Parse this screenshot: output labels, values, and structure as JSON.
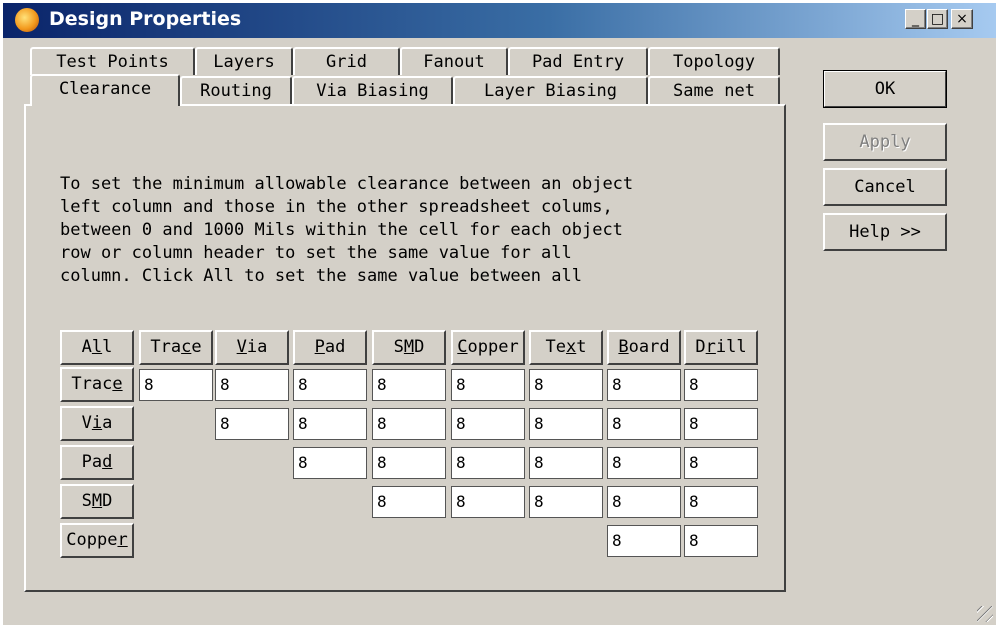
{
  "window": {
    "title": "Design Properties",
    "minimize_glyph": "_",
    "maximize_glyph": "□",
    "close_glyph": "×"
  },
  "tabs_row_back": [
    "Test Points",
    "Layers",
    "Grid",
    "Fanout",
    "Pad Entry",
    "Topology"
  ],
  "tabs_row_front": [
    "Clearance",
    "Routing",
    "Via Biasing",
    "Layer Biasing",
    "Same net"
  ],
  "active_tab": "Clearance",
  "description": [
    "To set the minimum allowable clearance between an object",
    "left column and those in the other spreadsheet colums,",
    "between 0 and 1000 Mils within the cell for each object",
    "row or column header to set the same value for all",
    "column. Click All to set the same value between all"
  ],
  "grid": {
    "corner": {
      "pre": "A",
      "u": "l",
      "post": "l"
    },
    "columns": [
      {
        "pre": "Tra",
        "u": "c",
        "post": "e"
      },
      {
        "pre": "",
        "u": "V",
        "post": "ia"
      },
      {
        "pre": "",
        "u": "P",
        "post": "ad"
      },
      {
        "pre": "S",
        "u": "M",
        "post": "D"
      },
      {
        "pre": "",
        "u": "C",
        "post": "opper"
      },
      {
        "pre": "Te",
        "u": "x",
        "post": "t"
      },
      {
        "pre": "",
        "u": "B",
        "post": "oard"
      },
      {
        "pre": "D",
        "u": "r",
        "post": "ill"
      }
    ],
    "rows": [
      {
        "label": {
          "pre": "Trac",
          "u": "e",
          "post": ""
        },
        "start": 0,
        "values": [
          "8",
          "8",
          "8",
          "8",
          "8",
          "8",
          "8",
          "8"
        ]
      },
      {
        "label": {
          "pre": "V",
          "u": "i",
          "post": "a"
        },
        "start": 1,
        "values": [
          "8",
          "8",
          "8",
          "8",
          "8",
          "8",
          "8"
        ]
      },
      {
        "label": {
          "pre": "Pa",
          "u": "d",
          "post": ""
        },
        "start": 2,
        "values": [
          "8",
          "8",
          "8",
          "8",
          "8",
          "8"
        ]
      },
      {
        "label": {
          "pre": "S",
          "u": "M",
          "post": "D"
        },
        "start": 3,
        "values": [
          "8",
          "8",
          "8",
          "8",
          "8"
        ]
      },
      {
        "label": {
          "pre": "Coppe",
          "u": "r",
          "post": ""
        },
        "start": 6,
        "values": [
          "8",
          "8"
        ]
      }
    ]
  },
  "buttons": {
    "ok": "OK",
    "apply": "Apply",
    "cancel": "Cancel",
    "help": "Help >>"
  }
}
